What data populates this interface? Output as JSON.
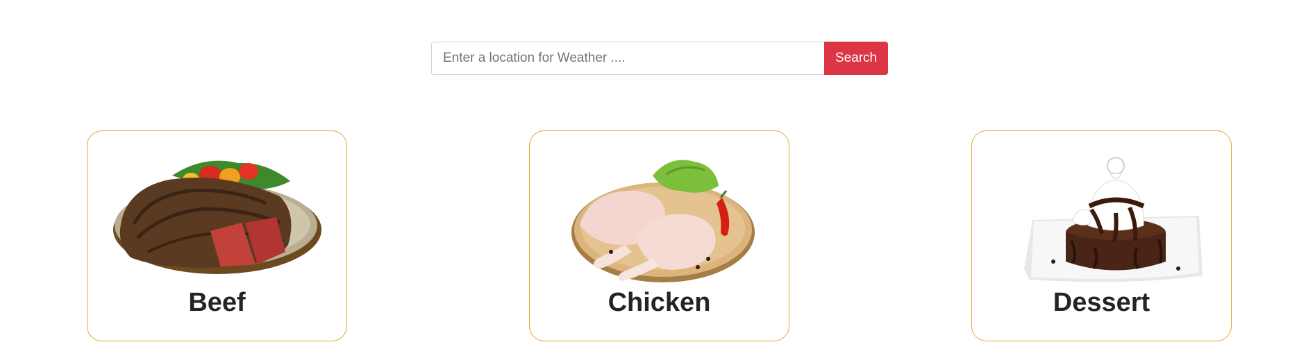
{
  "search": {
    "placeholder": "Enter a location for Weather ....",
    "value": "",
    "button_label": "Search",
    "button_color": "#dc3545"
  },
  "categories": [
    {
      "title": "Beef",
      "image": "grilled-steak-with-vegetables"
    },
    {
      "title": "Chicken",
      "image": "raw-chicken-legs-on-board"
    },
    {
      "title": "Dessert",
      "image": "chocolate-lava-cake-with-cream"
    }
  ],
  "card_border_color": "#e0a830"
}
